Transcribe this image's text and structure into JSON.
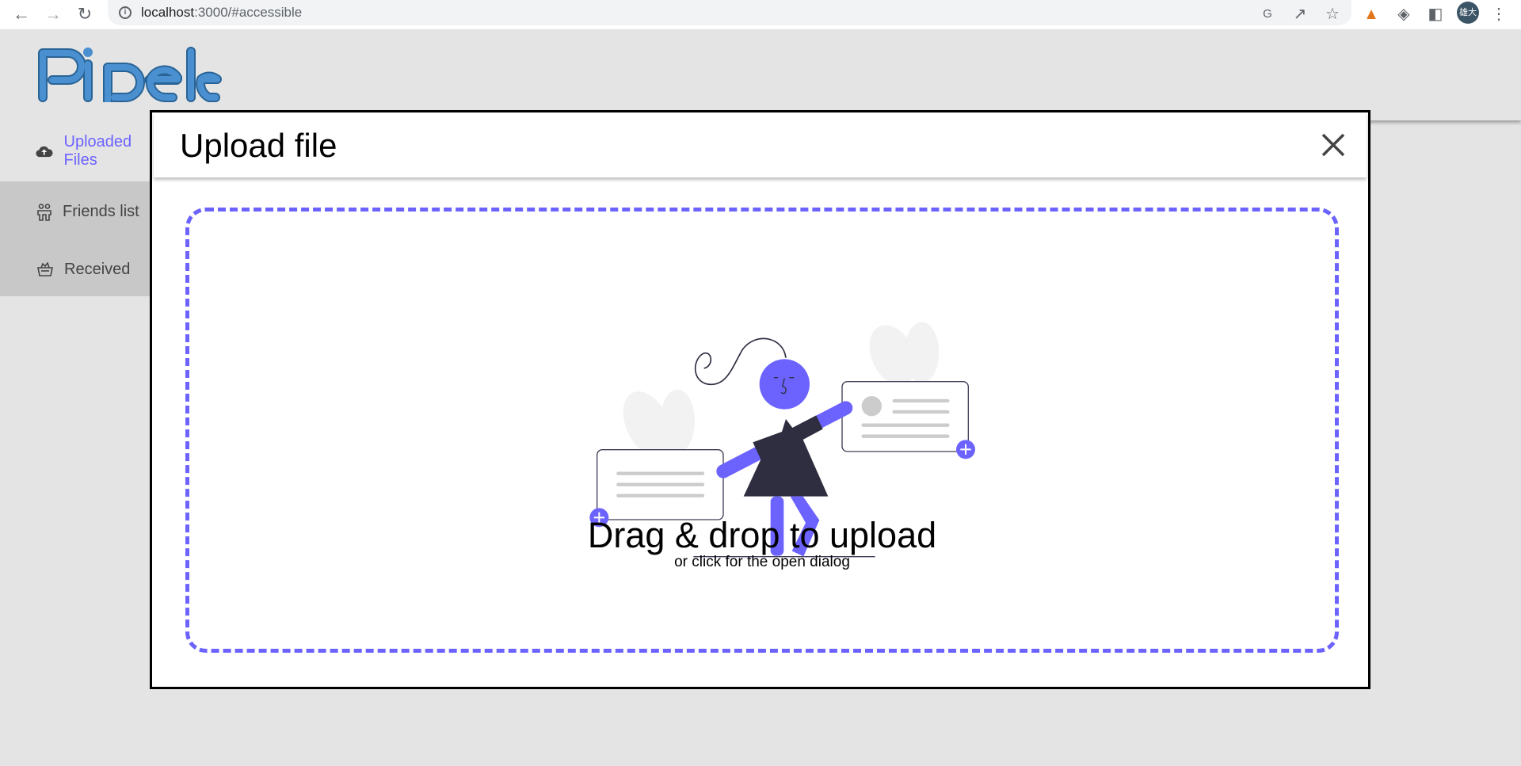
{
  "browser": {
    "url_host": "localhost",
    "url_rest": ":3000/#accessible",
    "avatar_text": "雄大"
  },
  "header": {
    "logo_text": "Pipele"
  },
  "sidebar": {
    "items": [
      {
        "label": "Uploaded Files",
        "icon": "cloud-upload-icon",
        "active": true
      },
      {
        "label": "Friends list",
        "icon": "friends-icon"
      },
      {
        "label": "Received",
        "icon": "basket-icon"
      }
    ]
  },
  "modal": {
    "title": "Upload file",
    "dropzone": {
      "title": "Drag & drop to upload",
      "subtitle": "or click for the open dialog"
    }
  },
  "colors": {
    "accent": "#6c63ff",
    "logo": "#3d85c6",
    "dark": "#2f2e41"
  }
}
